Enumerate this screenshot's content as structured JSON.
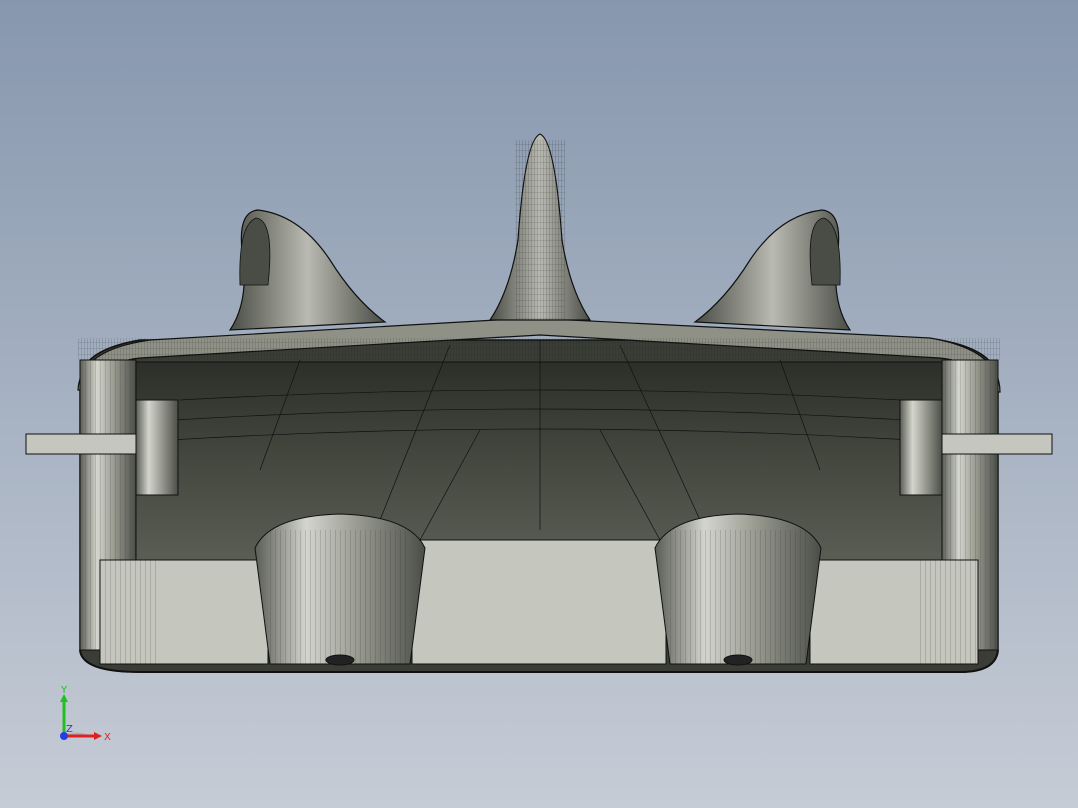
{
  "viewport": {
    "background_top": "#8797ae",
    "background_bottom": "#c6ccd6",
    "model": "cad-housing-section-view",
    "display_mode": "shaded-with-edges"
  },
  "triad": {
    "x_label": "X",
    "y_label": "Y",
    "z_label": "Z",
    "x_color": "#e02020",
    "y_color": "#20c020",
    "z_color": "#2040e0"
  },
  "colors": {
    "shade_light": "#c5c6bd",
    "shade_mid": "#8f9187",
    "shade_dark": "#3c3f38",
    "edge": "#111111"
  }
}
